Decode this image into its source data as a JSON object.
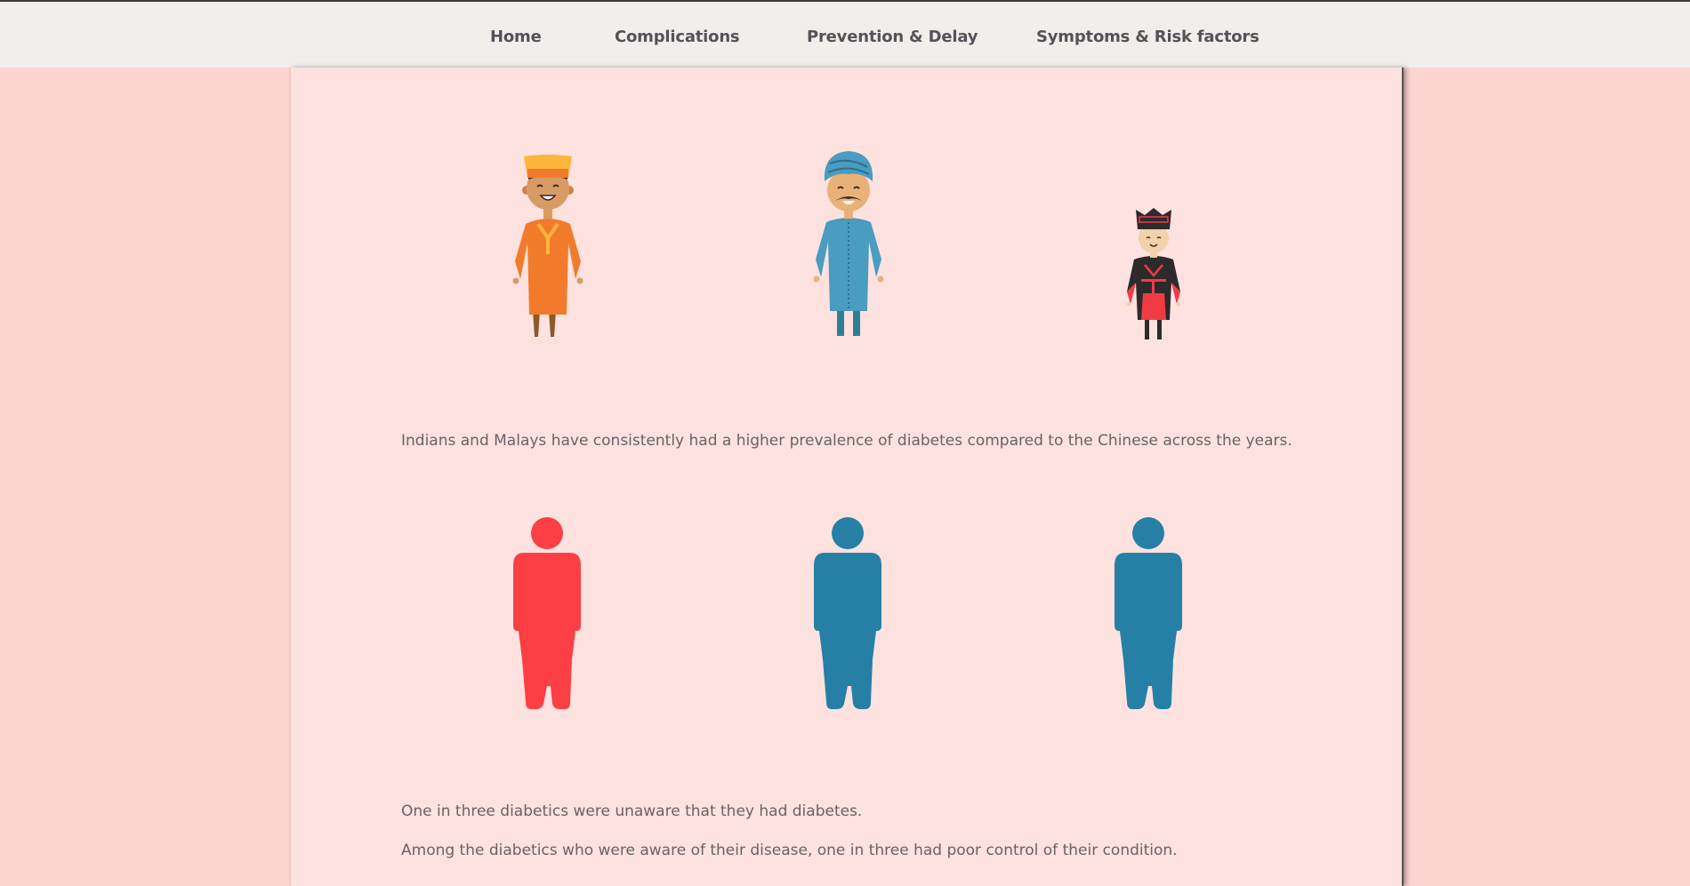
{
  "nav": {
    "items": [
      {
        "label": "Home"
      },
      {
        "label": "Complications"
      },
      {
        "label": "Prevention & Delay"
      },
      {
        "label": "Symptoms & Risk factors"
      }
    ]
  },
  "illustrations": {
    "people": [
      {
        "icon": "malay-man-illustration"
      },
      {
        "icon": "indian-man-illustration"
      },
      {
        "icon": "chinese-man-illustration"
      }
    ],
    "silhouettes": [
      {
        "icon": "person-icon",
        "color": "#fc3f44"
      },
      {
        "icon": "person-icon",
        "color": "#2680a6"
      },
      {
        "icon": "person-icon",
        "color": "#2680a6"
      }
    ]
  },
  "text": {
    "ethnicity_note": "Indians and Malays have consistently had a higher prevalence of diabetes compared to the Chinese across the years.",
    "unaware_note": "One in three diabetics were unaware that they had diabetes.",
    "control_note": "Among the diabetics who were aware of their disease, one in three had poor control of their condition."
  }
}
